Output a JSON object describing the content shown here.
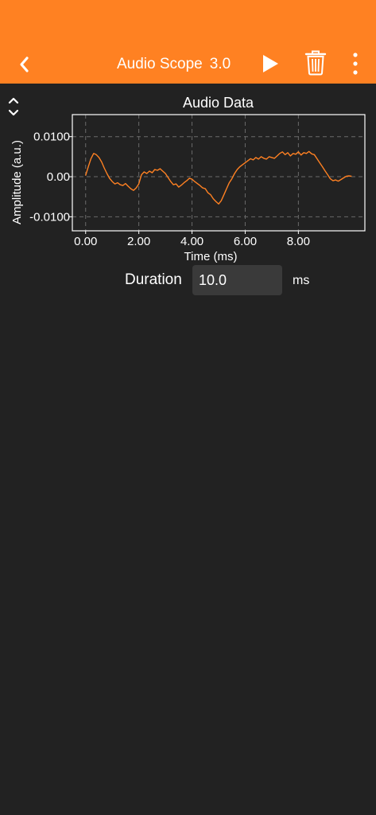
{
  "header": {
    "title": "Audio Scope",
    "version": "3.0",
    "background": "#ff8122",
    "icons": [
      "back-chevron-icon",
      "play-icon",
      "trash-icon",
      "more-vertical-icon"
    ]
  },
  "chart_data": {
    "type": "line",
    "title": "Audio Data",
    "xlabel": "Time (ms)",
    "ylabel": "Amplitude (a.u.)",
    "xlim": [
      -0.5,
      10.5
    ],
    "ylim": [
      -0.0135,
      0.0155
    ],
    "xticks": [
      "0.00",
      "2.00",
      "4.00",
      "6.00",
      "8.00"
    ],
    "yticks": [
      "0.0100",
      "0.00",
      "-0.0100"
    ],
    "grid": true,
    "line_color": "#ff8122",
    "series": [
      {
        "x": [
          0.0,
          0.1,
          0.2,
          0.3,
          0.4,
          0.5,
          0.6,
          0.7,
          0.8,
          0.9,
          1.0,
          1.1,
          1.2,
          1.3,
          1.4,
          1.5,
          1.6,
          1.7,
          1.8,
          1.9,
          2.0,
          2.1,
          2.2,
          2.3,
          2.4,
          2.5,
          2.6,
          2.7,
          2.8,
          2.9,
          3.0,
          3.1,
          3.2,
          3.3,
          3.4,
          3.5,
          3.6,
          3.7,
          3.8,
          3.9,
          4.0,
          4.1,
          4.2,
          4.3,
          4.4,
          4.5,
          4.6,
          4.7,
          4.8,
          4.9,
          5.0,
          5.1,
          5.2,
          5.3,
          5.4,
          5.5,
          5.6,
          5.7,
          5.8,
          5.9,
          6.0,
          6.1,
          6.2,
          6.3,
          6.4,
          6.5,
          6.6,
          6.7,
          6.8,
          6.9,
          7.0,
          7.1,
          7.2,
          7.3,
          7.4,
          7.5,
          7.6,
          7.7,
          7.8,
          7.9,
          8.0,
          8.1,
          8.2,
          8.3,
          8.4,
          8.5,
          8.6,
          8.7,
          8.8,
          8.9,
          9.0,
          9.1,
          9.2,
          9.3,
          9.4,
          9.5,
          9.6,
          9.7,
          9.8,
          9.9,
          10.0
        ],
        "y": [
          0.0003,
          0.0025,
          0.0045,
          0.0058,
          0.0055,
          0.0048,
          0.0037,
          0.0022,
          0.0008,
          -0.0004,
          -0.0012,
          -0.0018,
          -0.0015,
          -0.002,
          -0.0022,
          -0.0017,
          -0.0024,
          -0.003,
          -0.0034,
          -0.0028,
          -0.0018,
          0.0005,
          0.0012,
          0.0008,
          0.0014,
          0.001,
          0.0018,
          0.0016,
          0.002,
          0.0014,
          0.0008,
          -0.0002,
          -0.0012,
          -0.002,
          -0.0018,
          -0.0026,
          -0.0021,
          -0.0015,
          -0.001,
          -0.0004,
          -0.0006,
          -0.0012,
          -0.0017,
          -0.0022,
          -0.0028,
          -0.003,
          -0.004,
          -0.0045,
          -0.0055,
          -0.0062,
          -0.0068,
          -0.006,
          -0.0045,
          -0.003,
          -0.0015,
          -0.0005,
          0.0008,
          0.0018,
          0.0025,
          0.003,
          0.0035,
          0.004,
          0.0045,
          0.0042,
          0.0048,
          0.0044,
          0.005,
          0.0046,
          0.0044,
          0.005,
          0.0048,
          0.0046,
          0.0052,
          0.0058,
          0.0062,
          0.0055,
          0.006,
          0.0052,
          0.0058,
          0.0056,
          0.0062,
          0.0054,
          0.006,
          0.0058,
          0.0063,
          0.0057,
          0.0055,
          0.0045,
          0.0035,
          0.0025,
          0.0015,
          0.0005,
          -0.0005,
          -0.001,
          -0.0008,
          -0.0011,
          -0.0007,
          -0.0003,
          0.0001,
          0.0002,
          0.0001
        ]
      }
    ]
  },
  "duration": {
    "label": "Duration",
    "value": "10.0",
    "unit": "ms"
  }
}
